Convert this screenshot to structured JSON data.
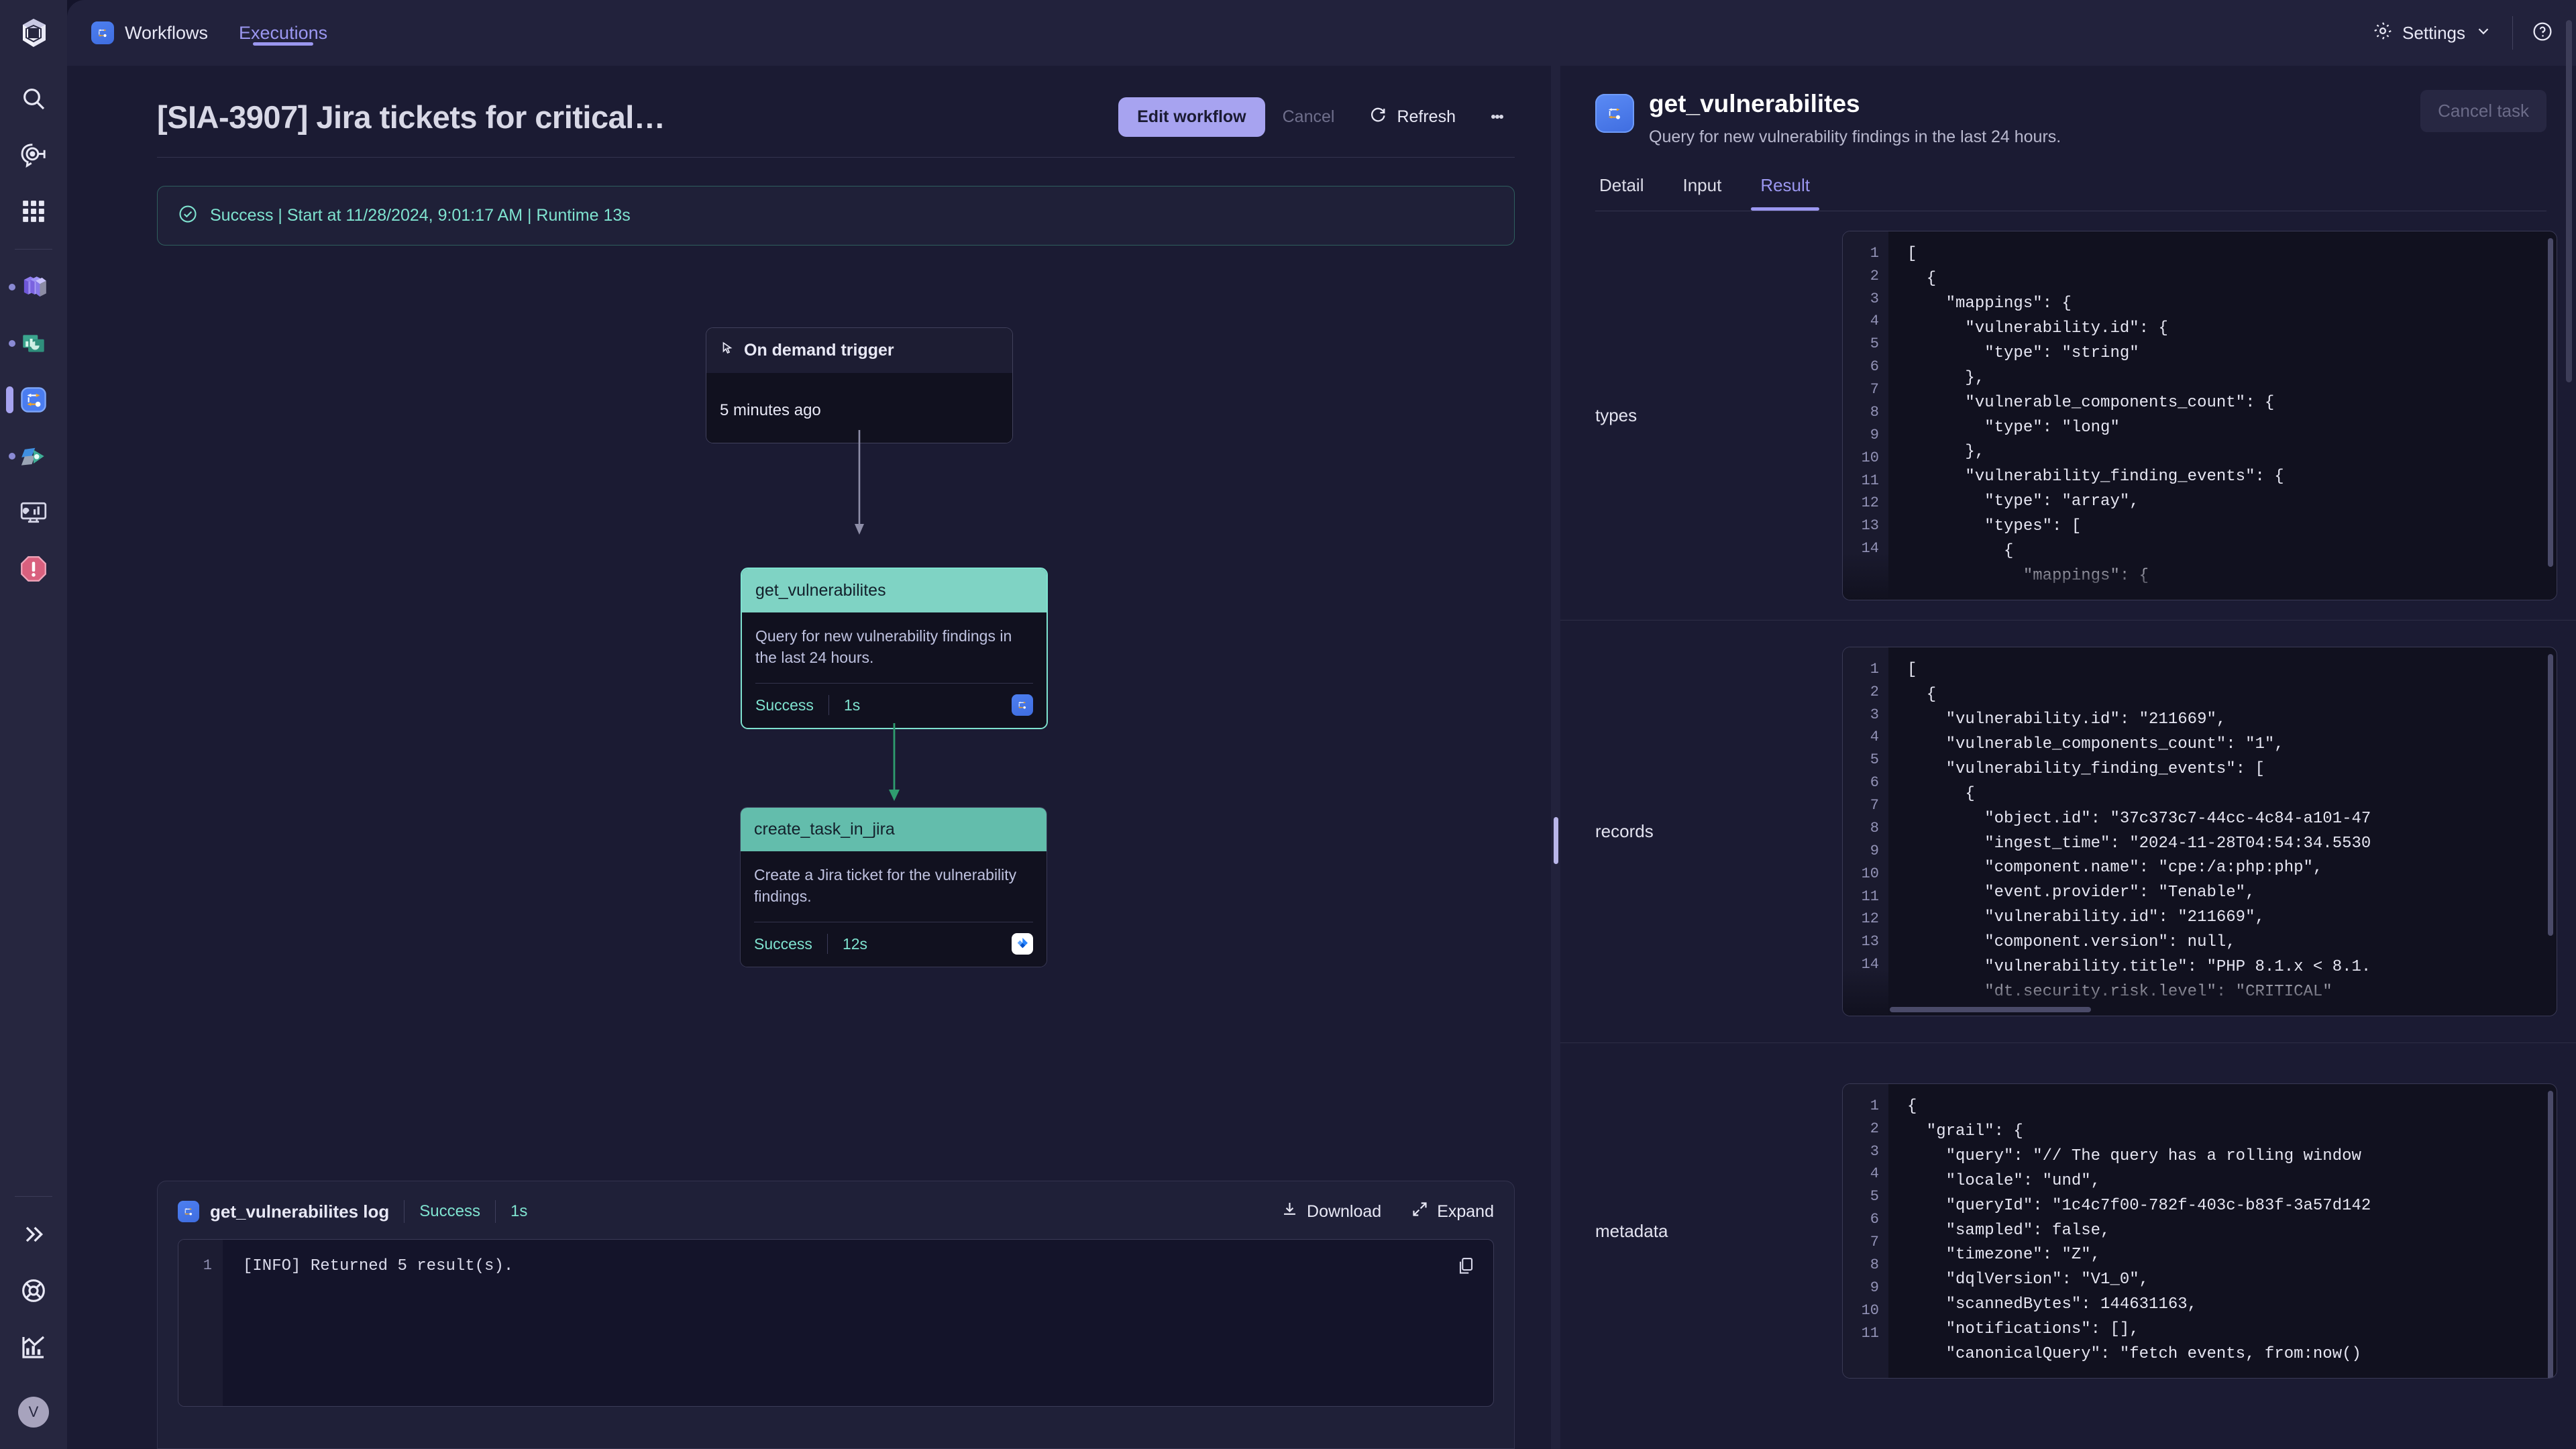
{
  "rail": {
    "logo_icon": "dynatrace-logo",
    "items": [
      {
        "icon": "search-icon",
        "name": "search",
        "state": "plain"
      },
      {
        "icon": "observe-explore-icon",
        "name": "observe-and-explore",
        "state": "plain"
      },
      {
        "icon": "apps-grid-icon",
        "name": "apps-grid",
        "state": "plain"
      },
      {
        "icon": "cube-stack-icon",
        "name": "distributed-tracing",
        "state": "dot"
      },
      {
        "icon": "dashboards-icon",
        "name": "dashboards",
        "state": "dot"
      },
      {
        "icon": "workflows-icon",
        "name": "workflows",
        "state": "active"
      },
      {
        "icon": "automation-icon",
        "name": "automation",
        "state": "dot"
      },
      {
        "icon": "monitor-chart-icon",
        "name": "monitoring",
        "state": "plain"
      },
      {
        "icon": "problems-alert-icon",
        "name": "problems",
        "state": "plain"
      }
    ],
    "bottom_items": [
      {
        "icon": "chevrons-right-icon",
        "name": "expand-rail"
      },
      {
        "icon": "lifebuoy-icon",
        "name": "support"
      },
      {
        "icon": "analytics-icon",
        "name": "analytics"
      }
    ],
    "avatar_initial": "V"
  },
  "topbar": {
    "app_icon": "workflows-icon",
    "nav": [
      {
        "label": "Workflows",
        "active": false
      },
      {
        "label": "Executions",
        "active": true
      }
    ],
    "settings_label": "Settings",
    "settings_icon": "gear-icon",
    "settings_chevron_icon": "chevron-down-icon",
    "help_icon": "help-circle-icon"
  },
  "execution": {
    "title": "[SIA-3907] Jira tickets for critical…",
    "actions": {
      "edit_workflow": "Edit workflow",
      "cancel": "Cancel",
      "refresh": "Refresh",
      "refresh_icon": "refresh-icon",
      "more_icon": "kebab-menu-icon"
    },
    "status_banner": {
      "icon": "check-circle-icon",
      "text": "Success | Start at 11/28/2024, 9:01:17 AM | Runtime 13s"
    },
    "nodes": [
      {
        "id": "trigger",
        "kind": "trigger",
        "icon": "cursor-pointer-icon",
        "title": "On demand trigger",
        "time": "5 minutes ago"
      },
      {
        "id": "get_vulnerabilites",
        "kind": "task",
        "selected": true,
        "title": "get_vulnerabilites",
        "description": "Query for new vulnerability findings in the last 24 hours.",
        "status": "Success",
        "duration": "1s",
        "app_icon": "workflows-icon"
      },
      {
        "id": "create_task_in_jira",
        "kind": "task",
        "selected": false,
        "title": "create_task_in_jira",
        "description": "Create a Jira ticket for the vulnerability findings.",
        "status": "Success",
        "duration": "12s",
        "app_icon": "jira-icon"
      }
    ],
    "log": {
      "app_icon": "workflows-icon",
      "title": "get_vulnerabilites log",
      "status": "Success",
      "duration": "1s",
      "download_label": "Download",
      "download_icon": "download-icon",
      "expand_label": "Expand",
      "expand_icon": "expand-icon",
      "copy_icon": "copy-icon",
      "line_numbers": [
        "1"
      ],
      "lines": [
        "[INFO] Returned 5 result(s)."
      ]
    }
  },
  "task_panel": {
    "app_icon": "workflows-icon",
    "title": "get_vulnerabilites",
    "description": "Query for new vulnerability findings in the last 24 hours.",
    "cancel_label": "Cancel task",
    "tabs": [
      {
        "label": "Detail",
        "active": false
      },
      {
        "label": "Input",
        "active": false
      },
      {
        "label": "Result",
        "active": true
      }
    ],
    "sections": [
      {
        "label": "types",
        "line_numbers": [
          "1",
          "2",
          "3",
          "4",
          "5",
          "6",
          "7",
          "8",
          "9",
          "10",
          "11",
          "12",
          "13",
          "14"
        ],
        "lines": [
          "[",
          "  {",
          "    \"mappings\": {",
          "      \"vulnerability.id\": {",
          "        \"type\": \"string\"",
          "      },",
          "      \"vulnerable_components_count\": {",
          "        \"type\": \"long\"",
          "      },",
          "      \"vulnerability_finding_events\": {",
          "        \"type\": \"array\",",
          "        \"types\": [",
          "          {",
          "            \"mappings\": {"
        ]
      },
      {
        "label": "records",
        "line_numbers": [
          "1",
          "2",
          "3",
          "4",
          "5",
          "6",
          "7",
          "8",
          "9",
          "10",
          "11",
          "12",
          "13",
          "14"
        ],
        "lines": [
          "[",
          "  {",
          "    \"vulnerability.id\": \"211669\",",
          "    \"vulnerable_components_count\": \"1\",",
          "    \"vulnerability_finding_events\": [",
          "      {",
          "        \"object.id\": \"37c373c7-44cc-4c84-a101-47",
          "        \"ingest_time\": \"2024-11-28T04:54:34.5530",
          "        \"component.name\": \"cpe:/a:php:php\",",
          "        \"event.provider\": \"Tenable\",",
          "        \"vulnerability.id\": \"211669\",",
          "        \"component.version\": null,",
          "        \"vulnerability.title\": \"PHP 8.1.x < 8.1.",
          "        \"dt.security.risk.level\": \"CRITICAL\""
        ]
      },
      {
        "label": "metadata",
        "line_numbers": [
          "1",
          "2",
          "3",
          "4",
          "5",
          "6",
          "7",
          "8",
          "9",
          "10",
          "11"
        ],
        "lines": [
          "{",
          "  \"grail\": {",
          "    \"query\": \"// The query has a rolling window",
          "    \"locale\": \"und\",",
          "    \"queryId\": \"1c4c7f00-782f-403c-b83f-3a57d142",
          "    \"sampled\": false,",
          "    \"timezone\": \"Z\",",
          "    \"dqlVersion\": \"V1_0\",",
          "    \"scannedBytes\": 144631163,",
          "    \"notifications\": [],",
          "    \"canonicalQuery\": \"fetch events, from:now()"
        ]
      }
    ]
  },
  "colors": {
    "accent": "#9b97f0",
    "success": "#7fe3d0",
    "rail_bg": "#26263f",
    "panel_bg": "#1b1b33",
    "code_bg": "#11111f"
  }
}
